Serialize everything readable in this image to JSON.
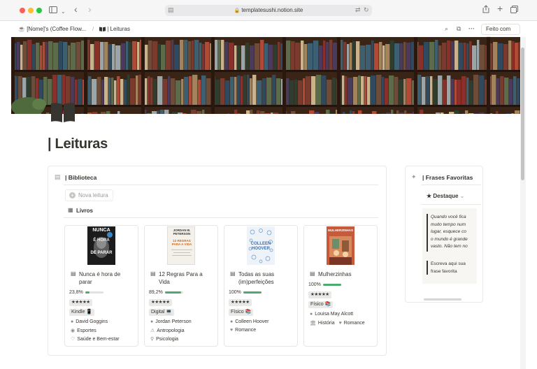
{
  "browser": {
    "url": "templatesushi.notion.site"
  },
  "notion": {
    "breadcrumb": [
      "[Nome]'s (Coffee Flow...",
      "| Leituras"
    ],
    "breadcrumb_sep": "/",
    "feito_com": "Feito com",
    "page_title": "| Leituras"
  },
  "biblioteca": {
    "title": "| Biblioteca",
    "new_button": "Nova leitura",
    "view_label": "Livros",
    "books": [
      {
        "title_lines": [
          "Nunca é hora de",
          "parar"
        ],
        "cover_text": [
          "NUNCA",
          "É HORA",
          "DE PARAR"
        ],
        "progress_label": "23,8%",
        "progress": 0.238,
        "stars": "★★★★★",
        "format": "Kindle 📱",
        "author": "David Goggins",
        "genre1": "Esportes",
        "genre2": "Saúde e Bem-estar"
      },
      {
        "title_lines": [
          "12 Regras Para a",
          "Vida"
        ],
        "cover_text": [
          "JORDAN B.",
          "PETERSON",
          "12 REGRAS",
          "PARA A VIDA"
        ],
        "progress_label": "89,2%",
        "progress": 0.892,
        "stars": "★★★★★",
        "format": "Digital 💻",
        "author": "Jordan Peterson",
        "genre1": "Antropologia",
        "genre2": "Psicologia"
      },
      {
        "title_lines": [
          "Todas as suas",
          "(im)perfeições"
        ],
        "cover_text": [
          "COLLEEN",
          "HOOVER"
        ],
        "progress_label": "100%",
        "progress": 1.0,
        "stars": "★★★★★",
        "format": "Físico 📚",
        "author": "Colleen Hoover",
        "genre1": "Romance",
        "genre2": ""
      },
      {
        "title_lines": [
          "Mulherzinhas",
          ""
        ],
        "cover_text": [
          "MULHERZINHAS"
        ],
        "progress_label": "100%",
        "progress": 1.0,
        "stars": "★★★★★",
        "format": "Físico 📚",
        "author": "Louisa May Alcott",
        "genre1": "História",
        "genre2": "Romance"
      }
    ]
  },
  "frases": {
    "title": "| Frases Favoritas",
    "view_label": "Destaque",
    "quote_lines": [
      "Quando você fica",
      "muito tempo num",
      "lugar, esquece co",
      "o mundo é grande",
      "vasto. Não tem no"
    ],
    "placeholder_lines": [
      "Escreva aqui sua",
      "frase favorita"
    ]
  },
  "icons": {
    "page": "open-book-icon",
    "sidebar": "sidebar-icon",
    "search": "search-icon"
  },
  "colors": {
    "progress": "#4dab6f",
    "text": "#37352f",
    "muted": "#9b9a97"
  }
}
